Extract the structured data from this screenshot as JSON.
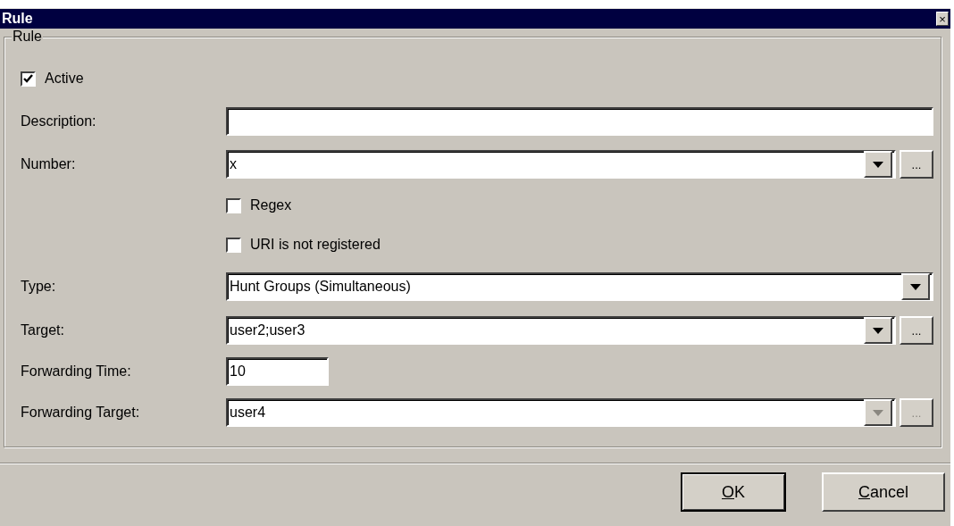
{
  "window": {
    "title": "Rule",
    "close": "×"
  },
  "group": {
    "title": "Rule"
  },
  "rows": [
    {
      "kind": "checkbox",
      "label": "Active",
      "checked": true,
      "indent": false
    },
    {
      "kind": "text",
      "label": "Description:",
      "value": ""
    },
    {
      "kind": "combo",
      "label": "Number:",
      "value": "x",
      "browse": "...",
      "disabled": false
    },
    {
      "kind": "checkbox",
      "label": "Regex",
      "checked": false,
      "indent": true
    },
    {
      "kind": "checkbox",
      "label": "URI is not registered",
      "checked": false,
      "indent": true
    },
    {
      "kind": "combo",
      "label": "Type:",
      "value": "Hunt Groups (Simultaneous)",
      "disabled": false
    },
    {
      "kind": "combo",
      "label": "Target:",
      "value": "user2;user3",
      "browse": "...",
      "disabled": false
    },
    {
      "kind": "short",
      "label": "Forwarding Time:",
      "value": "10"
    },
    {
      "kind": "combo",
      "label": "Forwarding Target:",
      "value": "user4",
      "browse": "...",
      "disabled": true
    }
  ],
  "buttons": [
    {
      "label": "OK",
      "underline_first": true,
      "default": true
    },
    {
      "label": "Cancel",
      "underline_first": true,
      "default": false
    }
  ]
}
